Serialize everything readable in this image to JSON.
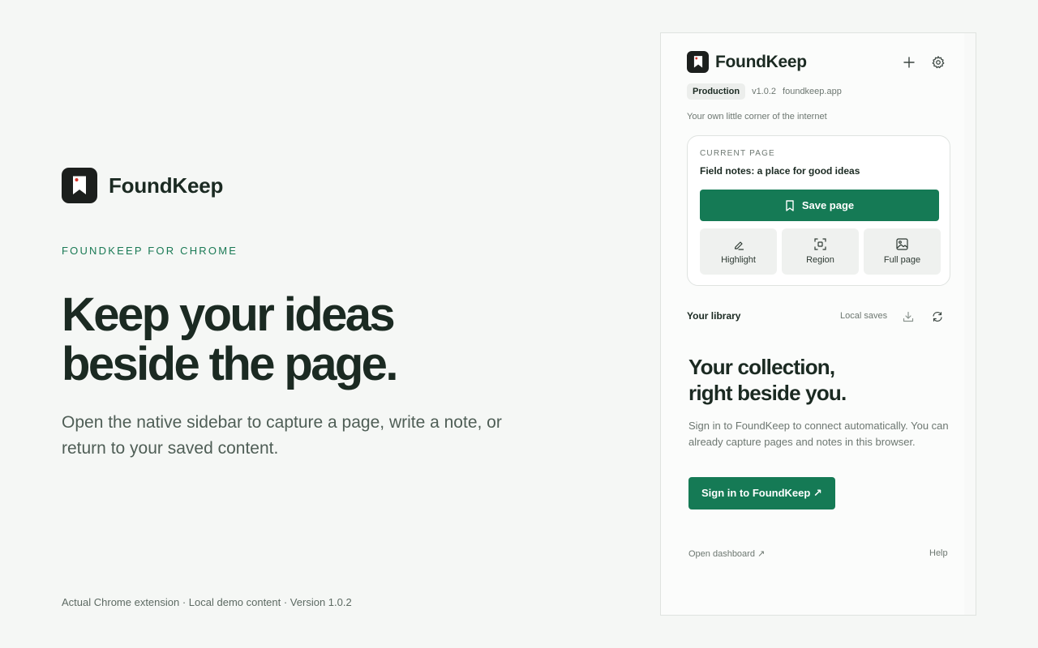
{
  "hero": {
    "brand_name": "FoundKeep",
    "eyebrow": "FOUNDKEEP FOR CHROME",
    "headline_line1": "Keep your ideas",
    "headline_line2": "beside the page.",
    "lead": "Open the native sidebar to capture a page, write a note, or return to your saved content.",
    "footnote": "Actual Chrome extension · Local demo content · Version 1.0.2"
  },
  "sidebar": {
    "title": "FoundKeep",
    "env_badge": "Production",
    "version": "v1.0.2",
    "domain": "foundkeep.app",
    "tagline": "Your own little corner of the internet",
    "current_page": {
      "label": "CURRENT PAGE",
      "title": "Field notes: a place for good ideas",
      "save_label": "Save page",
      "tools": [
        {
          "label": "Highlight",
          "icon": "highlight-icon"
        },
        {
          "label": "Region",
          "icon": "region-icon"
        },
        {
          "label": "Full page",
          "icon": "image-icon"
        }
      ]
    },
    "library": {
      "title": "Your library",
      "status": "Local saves"
    },
    "empty_state": {
      "title_line1": "Your collection,",
      "title_line2": "right beside you.",
      "body": "Sign in to FoundKeep to connect automatically. You can already capture pages and notes in this browser.",
      "cta": "Sign in to FoundKeep ↗"
    },
    "footer": {
      "dashboard": "Open dashboard ↗",
      "help": "Help"
    }
  },
  "colors": {
    "background": "#f5f7f5",
    "accent": "#157a55",
    "eyebrow": "#1a7a55",
    "logo_bg": "#1c1f1d",
    "logo_dot": "#d8342b"
  }
}
